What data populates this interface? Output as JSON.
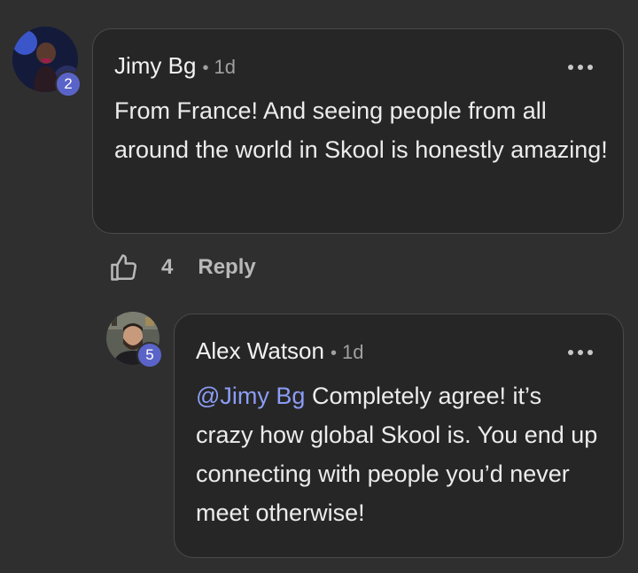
{
  "comment": {
    "author": "Jimy Bg",
    "separator": "•",
    "time": "1d",
    "level": "2",
    "text": "From France! And seeing people from all around the world in Skool is honestly amazing!",
    "like_count": "4",
    "reply_label": "Reply"
  },
  "reply": {
    "author": "Alex Watson",
    "separator": "•",
    "time": "1d",
    "level": "5",
    "mention": "@Jimy Bg",
    "text": " Completely agree! it’s crazy how global Skool is. You end up connecting with people you’d never meet otherwise!"
  },
  "colors": {
    "background": "#2f2f30",
    "bubble": "#262626",
    "mention": "#8b9df5",
    "badge": "#5a64c8"
  },
  "icons": {
    "more": "more-horizontal-icon",
    "like": "thumbs-up-icon"
  }
}
